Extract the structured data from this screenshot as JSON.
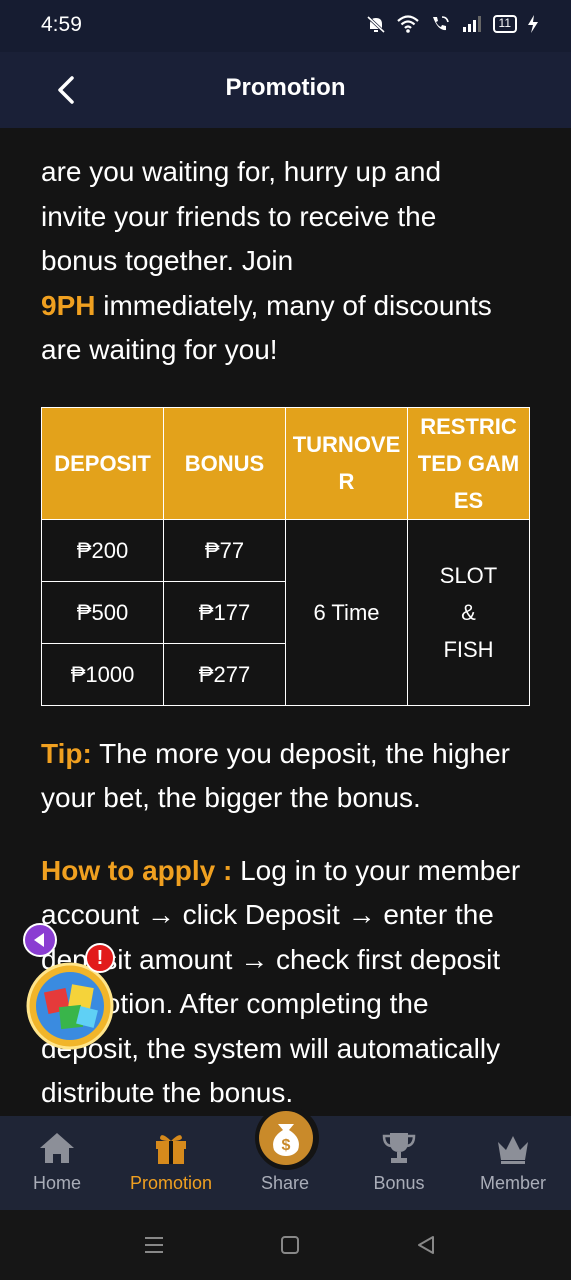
{
  "status_bar": {
    "time": "4:59",
    "battery": "11",
    "icons": [
      "mute-icon",
      "wifi-icon",
      "call-icon",
      "signal-icon",
      "battery-icon",
      "charging-icon"
    ]
  },
  "header": {
    "title": "Promotion",
    "back_icon": "chevron-left-icon"
  },
  "content": {
    "intro_line1": "are you waiting for, hurry up and",
    "intro_line2": "invite your friends to receive the",
    "intro_line3": "bonus together. Join",
    "intro_brand": "9PH",
    "intro_line4_rest": " immediately, many of discounts",
    "intro_line5": "are waiting for you!",
    "table": {
      "headers": [
        "DEPOSIT",
        "BONUS",
        "TURNOVER",
        "RESTRICTED GAMES"
      ],
      "rows": [
        {
          "deposit": "₱200",
          "bonus": "₱77"
        },
        {
          "deposit": "₱500",
          "bonus": "₱177"
        },
        {
          "deposit": "₱1000",
          "bonus": "₱277"
        }
      ],
      "turnover": "6 Time",
      "restricted_line1": "SLOT",
      "restricted_line2": "&",
      "restricted_line3": "FISH"
    },
    "tip_label": "Tip:",
    "tip_text": " The more you deposit, the higher your bet, the bigger the bonus.",
    "apply_label": "How to apply :",
    "apply_text": " Log in to your member account → click Deposit → enter the deposit amount → check first deposit promotion. After completing the deposit, the system will automatically distribute the bonus."
  },
  "floating_widget": {
    "badge": "!",
    "arrow_icon": "arrow-left-icon",
    "gift_icon": "gift-box-icon"
  },
  "bottom_nav": {
    "items": [
      {
        "label": "Home",
        "icon": "home-icon"
      },
      {
        "label": "Promotion",
        "icon": "gift-icon",
        "active": true
      },
      {
        "label": "Share",
        "icon": "money-bag-icon"
      },
      {
        "label": "Bonus",
        "icon": "trophy-icon"
      },
      {
        "label": "Member",
        "icon": "crown-icon"
      }
    ]
  },
  "colors": {
    "accent": "#f0a020",
    "table_header": "#e3a21b",
    "header_bg": "#1a2037",
    "nav_bg": "#1f2536"
  }
}
